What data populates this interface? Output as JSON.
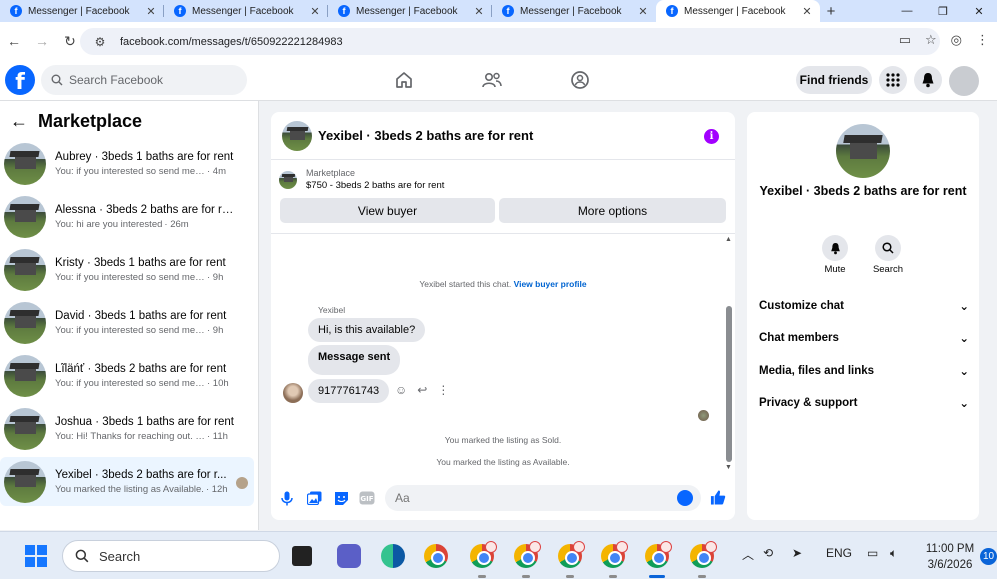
{
  "browser": {
    "tabs": [
      {
        "title": "Messenger | Facebook",
        "active": false
      },
      {
        "title": "Messenger | Facebook",
        "active": false
      },
      {
        "title": "Messenger | Facebook",
        "active": false
      },
      {
        "title": "Messenger | Facebook",
        "active": false
      },
      {
        "title": "Messenger | Facebook",
        "active": true
      }
    ],
    "url": "facebook.com/messages/t/650922221284983"
  },
  "fbnav": {
    "search_placeholder": "Search Facebook",
    "find_friends": "Find friends",
    "brand_color": "#0866ff"
  },
  "marketplace": {
    "title": "Marketplace",
    "conversations": [
      {
        "name": "Aubrey · 3beds 1 baths are for rent",
        "snippet": "You: if you interested so send me nu...",
        "time": "· 4m"
      },
      {
        "name": "Alessna · 3beds 2 baths are for rent",
        "snippet": "You: hi are you interested",
        "time": "· 26m"
      },
      {
        "name": "Kristy · 3beds 1 baths are for rent",
        "snippet": "You: if you interested so send me nu...",
        "time": "· 9h"
      },
      {
        "name": "David · 3beds 1 baths are for rent",
        "snippet": "You: if you interested so send me nu...",
        "time": "· 9h"
      },
      {
        "name": "Ĺĩĺäńť · 3beds 2 baths are for rent",
        "snippet": "You: if you interested so send me nu...",
        "time": "· 10h"
      },
      {
        "name": "Joshua · 3beds 1 baths are for rent",
        "snippet": "You: Hi! Thanks for reaching out. Yes,...",
        "time": "· 11h"
      },
      {
        "name": "Yexibel · 3beds 2 baths are for r...",
        "snippet": "You marked the listing as Available.",
        "time": "· 12h"
      }
    ]
  },
  "chat": {
    "title": "Yexibel · 3beds 2 baths are for rent",
    "listing_caption": "Marketplace",
    "listing_price": "$750 - 3beds 2 baths are for rent",
    "view_buyer": "View buyer",
    "more_options": "More options",
    "started_text": "Yexibel started this chat.",
    "buyer_profile_link": "View buyer profile",
    "sender_name": "Yexibel",
    "messages": [
      "Hi, is this available?",
      "Message sent",
      "9177761743"
    ],
    "sold_text": "You marked the listing as Sold.",
    "available_text": "You marked the listing as Available.",
    "input_placeholder": "Aa",
    "accent": "#a200ff"
  },
  "details": {
    "title": "Yexibel · 3beds 2 baths are for rent",
    "mute": "Mute",
    "search": "Search",
    "sections": [
      "Customize chat",
      "Chat members",
      "Media, files and links",
      "Privacy & support"
    ]
  },
  "taskbar": {
    "search_label": "Search",
    "language": "ENG",
    "time": "11:00 PM",
    "date": "3/6/2026",
    "notifications": "10"
  }
}
